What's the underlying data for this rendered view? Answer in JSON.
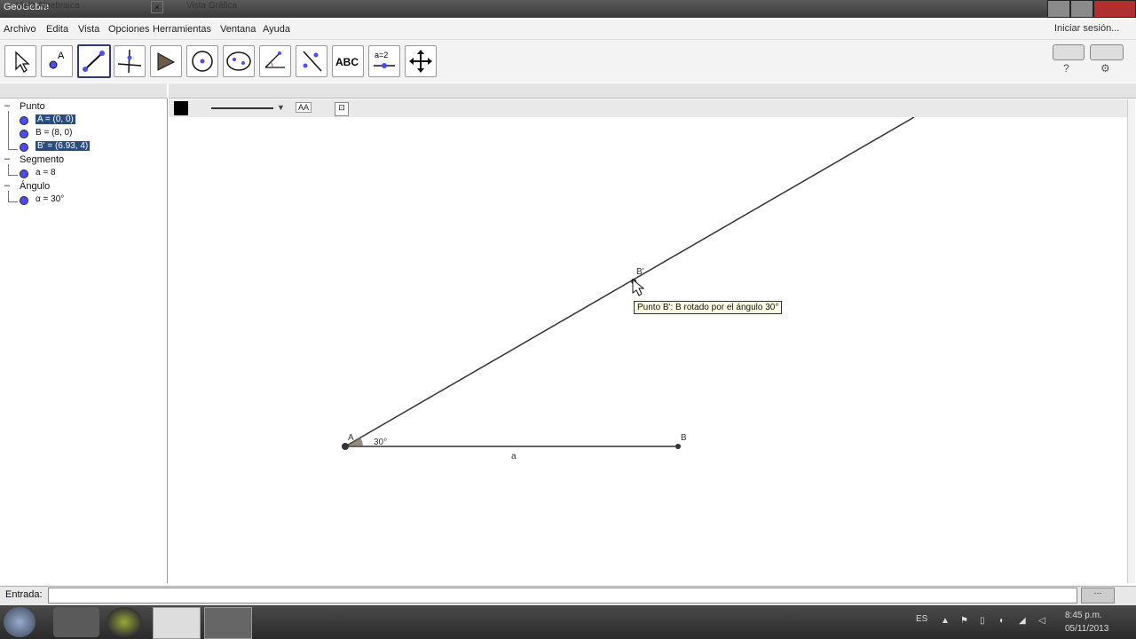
{
  "window": {
    "title": "GeoGebra"
  },
  "menu": {
    "items": [
      "Archivo",
      "Edita",
      "Vista",
      "Opciones",
      "Herramientas",
      "Ventana",
      "Ayuda"
    ],
    "session": "Iniciar sesión..."
  },
  "toolbar": {
    "tools": [
      "move-tool",
      "point-tool",
      "line-tool",
      "perpendicular-tool",
      "polygon-tool",
      "circle-tool",
      "conic-tool",
      "angle-tool",
      "reflect-tool",
      "text-tool",
      "slider-tool",
      "move-view-tool"
    ],
    "text_tool_label": "ABC",
    "slider_tool_label": "a=2"
  },
  "algebra": {
    "title": "Vista Algebraica",
    "categories": [
      {
        "name": "Punto",
        "objects": [
          "A = (0, 0)",
          "B = (8, 0)",
          "B' = (6.93, 4)"
        ]
      },
      {
        "name": "Segmento",
        "objects": [
          "a = 8"
        ]
      },
      {
        "name": "Ángulo",
        "objects": [
          "α = 30°"
        ]
      }
    ]
  },
  "graphics": {
    "title": "Vista Gráfica",
    "label_style": "AA",
    "tooltip": "Punto B': B rotado por el ángulo 30°",
    "labels": {
      "A": "A",
      "B": "B",
      "B_prime": "B'",
      "segment": "a",
      "angle": "30°"
    }
  },
  "input": {
    "label": "Entrada:"
  },
  "taskbar": {
    "lang": "ES",
    "time": "8:45 p.m.",
    "date": "05/11/2013"
  },
  "colors": {
    "point": "#4c4cff",
    "selected_border": "#2e3c6e",
    "highlight": "#2b4c7e"
  }
}
